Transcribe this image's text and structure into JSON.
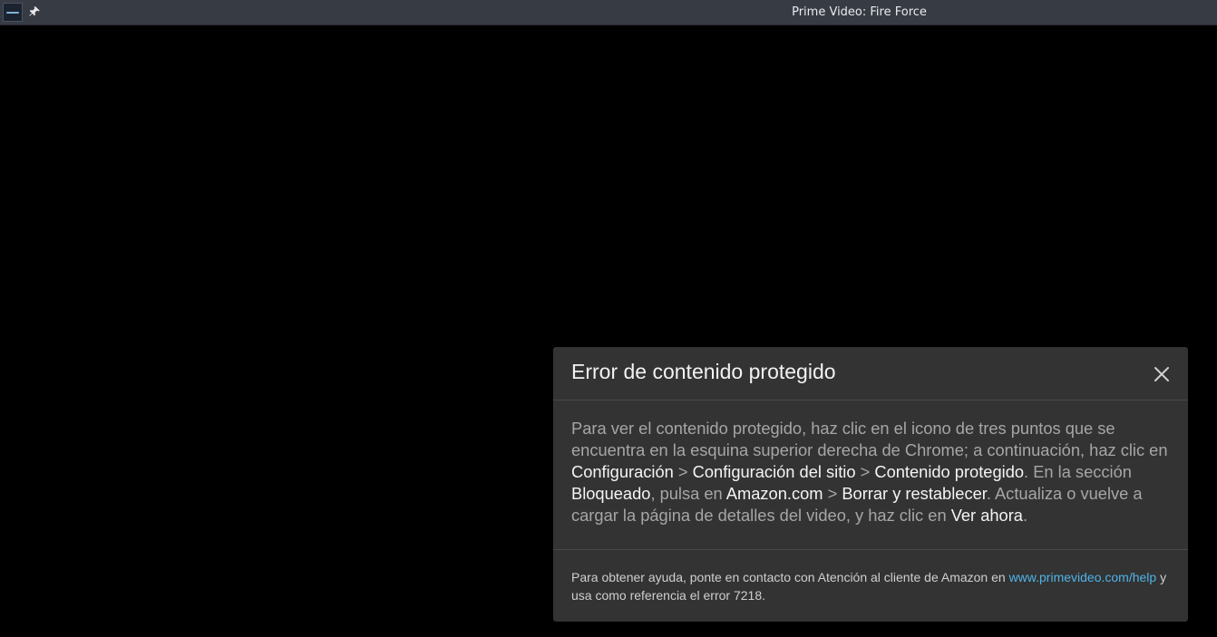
{
  "window": {
    "title": "Prime Video: Fire Force",
    "icons": [
      "app-thumbnail-icon",
      "pin-icon"
    ]
  },
  "dialog": {
    "title": "Error de contenido protegido",
    "close_icon": "close-icon",
    "body": {
      "t1": "Para ver el contenido protegido, haz clic en el icono de tres puntos que se encuentra en la esquina superior derecha de Chrome; a continuación, haz clic en ",
      "h1": "Configuración",
      "t2": " > ",
      "h2": "Configuración del sitio",
      "t3": " > ",
      "h3": "Contenido protegido",
      "t4": ". En la sección ",
      "h4": "Bloqueado",
      "t5": ", pulsa en ",
      "h5": "Amazon.com",
      "t6": " > ",
      "h6": "Borrar y restablecer",
      "t7": ". Actualiza o vuelve a cargar la página de detalles del video, y haz clic en ",
      "h7": "Ver ahora",
      "t8": "."
    },
    "footer": {
      "text_before": "Para obtener ayuda, ponte en contacto con Atención al cliente de Amazon en ",
      "link": "www.primevideo.com/help",
      "text_after": " y usa como referencia el error 7218."
    }
  },
  "colors": {
    "titlebar_bg": "#373b44",
    "video_bg": "#000000",
    "dialog_bg": "#333333",
    "body_text": "#a6a6a6",
    "highlight_text": "#f4f4f4",
    "link": "#4fb3e8"
  }
}
